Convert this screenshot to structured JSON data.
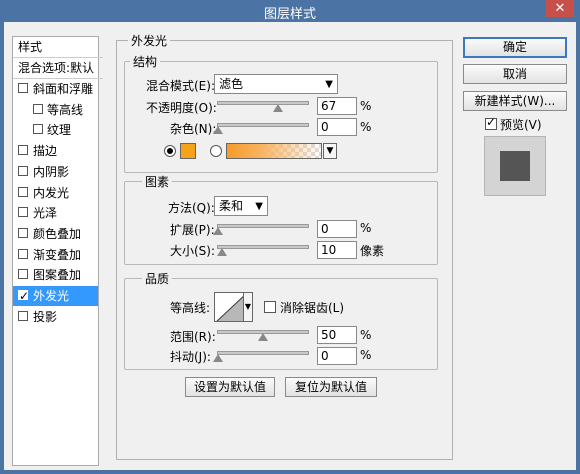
{
  "window": {
    "title": "图层样式",
    "close_symbol": "✕"
  },
  "left_panel": {
    "header_styles": "样式",
    "header_blend": "混合选项:默认",
    "items": [
      {
        "label": "斜面和浮雕",
        "checked": false,
        "sub": false
      },
      {
        "label": "等高线",
        "checked": false,
        "sub": true
      },
      {
        "label": "纹理",
        "checked": false,
        "sub": true
      },
      {
        "label": "描边",
        "checked": false,
        "sub": false
      },
      {
        "label": "内阴影",
        "checked": false,
        "sub": false
      },
      {
        "label": "内发光",
        "checked": false,
        "sub": false
      },
      {
        "label": "光泽",
        "checked": false,
        "sub": false
      },
      {
        "label": "颜色叠加",
        "checked": false,
        "sub": false
      },
      {
        "label": "渐变叠加",
        "checked": false,
        "sub": false
      },
      {
        "label": "图案叠加",
        "checked": false,
        "sub": false
      },
      {
        "label": "外发光",
        "checked": true,
        "sub": false,
        "selected": true
      },
      {
        "label": "投影",
        "checked": false,
        "sub": false
      }
    ]
  },
  "main": {
    "title": "外发光",
    "structure": {
      "legend": "结构",
      "blend_mode_label": "混合模式(E):",
      "blend_mode_value": "滤色",
      "opacity_label": "不透明度(O):",
      "opacity_value": "67",
      "opacity_unit": "%",
      "opacity_fraction": 0.67,
      "noise_label": "杂色(N):",
      "noise_value": "0",
      "noise_unit": "%",
      "noise_fraction": 0,
      "solid_color": "#f7a21b",
      "gradient_selected": false,
      "solid_selected": true
    },
    "elements": {
      "legend": "图素",
      "method_label": "方法(Q):",
      "method_value": "柔和",
      "spread_label": "扩展(P):",
      "spread_value": "0",
      "spread_unit": "%",
      "spread_fraction": 0,
      "size_label": "大小(S):",
      "size_value": "10",
      "size_unit": "像素",
      "size_fraction": 0.04
    },
    "quality": {
      "legend": "品质",
      "contour_label": "等高线:",
      "antialias_label": "消除锯齿(L)",
      "antialias_checked": false,
      "range_label": "范围(R):",
      "range_value": "50",
      "range_unit": "%",
      "range_fraction": 0.5,
      "jitter_label": "抖动(J):",
      "jitter_value": "0",
      "jitter_unit": "%",
      "jitter_fraction": 0
    },
    "set_default": "设置为默认值",
    "reset_default": "复位为默认值"
  },
  "right": {
    "ok": "确定",
    "cancel": "取消",
    "new_style": "新建样式(W)...",
    "preview_label": "预览(V)",
    "preview_checked": true
  }
}
